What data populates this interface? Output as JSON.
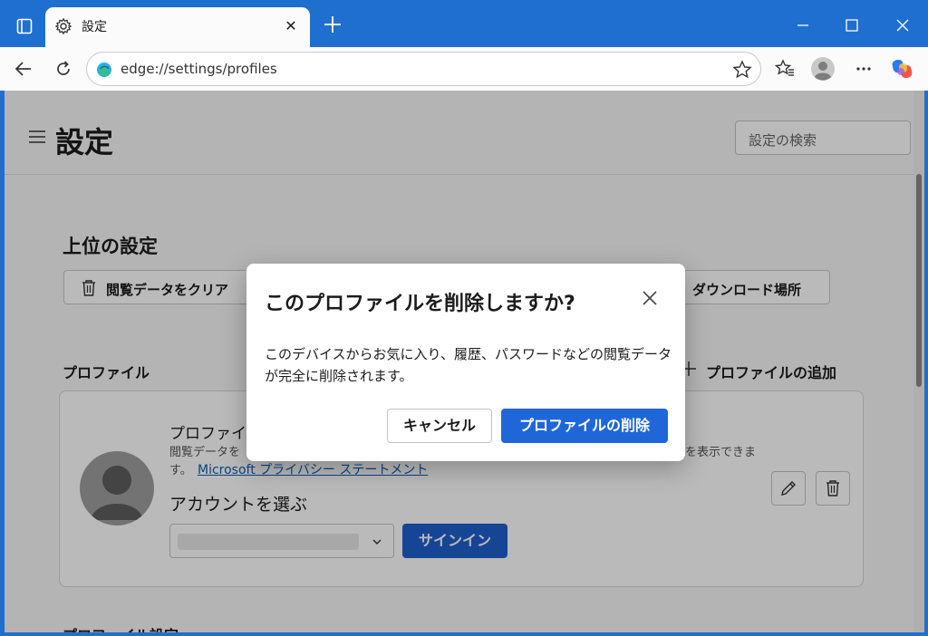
{
  "browser": {
    "tab_title": "設定",
    "url": "edge://settings/profiles"
  },
  "page": {
    "title": "設定",
    "search_placeholder": "設定の検索",
    "top_settings": {
      "title": "上位の設定",
      "clear_data_label": "閲覧データをクリア",
      "download_location_label": "ダウンロード場所"
    },
    "profiles": {
      "title": "プロファイル",
      "add_profile_label": "プロファイルの追加",
      "profile_name": "プロファイ",
      "desc_line1": "閲覧データを",
      "desc_line1_tail": "を表示できま",
      "desc_line2_prefix": "す。",
      "privacy_link": "Microsoft プライバシー ステートメント",
      "choose_account": "アカウントを選ぶ",
      "signin_label": "サインイン"
    },
    "next_section": "プロファイル設定"
  },
  "dialog": {
    "title": "このプロファイルを削除しますか?",
    "body": "このデバイスからお気に入り、履歴、パスワードなどの閲覧データが完全に削除されます。",
    "cancel_label": "キャンセル",
    "delete_label": "プロファイルの削除"
  },
  "colors": {
    "titlebar": "#1f6fd1",
    "primary_button": "#1f67d8",
    "link": "#0f5bb8"
  }
}
